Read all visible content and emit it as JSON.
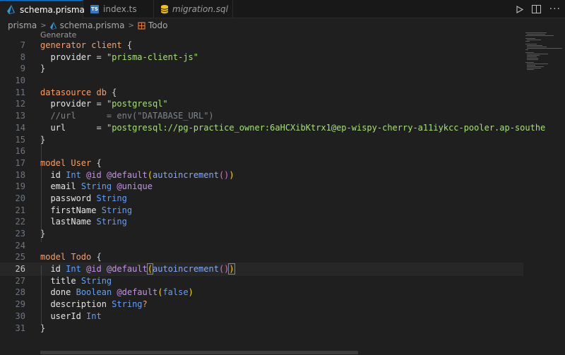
{
  "tabs": [
    {
      "label": "schema.prisma",
      "active": true,
      "icon": "prisma-icon",
      "close": "✕"
    },
    {
      "label": "index.ts",
      "active": false,
      "icon": "ts-icon",
      "icon_text": "TS"
    },
    {
      "label": "migration.sql",
      "active": false,
      "icon": "database-icon",
      "italic": true
    }
  ],
  "breadcrumb": {
    "folder": "prisma",
    "file": "schema.prisma",
    "symbol": "Todo"
  },
  "codelens": "Generate",
  "colors": {
    "accent": "#0078d4",
    "prisma_icon": "#2d9cdb",
    "sql_icon": "#f1c40f",
    "model_icon": "#e37933"
  },
  "lines": [
    {
      "n": "7"
    },
    {
      "n": "8"
    },
    {
      "n": "9"
    },
    {
      "n": "10"
    },
    {
      "n": "11"
    },
    {
      "n": "12"
    },
    {
      "n": "13"
    },
    {
      "n": "14"
    },
    {
      "n": "15"
    },
    {
      "n": "16"
    },
    {
      "n": "17"
    },
    {
      "n": "18"
    },
    {
      "n": "19"
    },
    {
      "n": "20"
    },
    {
      "n": "21"
    },
    {
      "n": "22"
    },
    {
      "n": "23"
    },
    {
      "n": "24"
    },
    {
      "n": "25"
    },
    {
      "n": "26"
    },
    {
      "n": "27"
    },
    {
      "n": "28"
    },
    {
      "n": "29"
    },
    {
      "n": "30"
    },
    {
      "n": "31"
    }
  ],
  "tokens": {
    "generator": "generator",
    "client": "client",
    "lbrace": "{",
    "rbrace": "}",
    "provider": "provider",
    "eq": "=",
    "prisma_client_js": "\"prisma-client-js\"",
    "datasource": "datasource",
    "db": "db",
    "postgresql": "\"postgresql\"",
    "url_comment": "//url      = env(\"DATABASE_URL\")",
    "url": "url",
    "url_value": "\"postgresql://pg-practice_owner:6aHCXibKtrx1@ep-wispy-cherry-a11iykcc-pooler.ap-southe",
    "model": "model",
    "User": "User",
    "Todo": "Todo",
    "id": "id",
    "Int": "Int",
    "at_id": "@id",
    "at_default": "@default",
    "lparen": "(",
    "rparen": ")",
    "autoincrement": "autoincrement",
    "empty_parens": "()",
    "email": "email",
    "String": "String",
    "at_unique": "@unique",
    "password": "password",
    "firstName": "firstName",
    "lastName": "lastName",
    "title": "title",
    "done": "done",
    "Boolean": "Boolean",
    "false": "false",
    "description": "description",
    "qmark": "?",
    "userId": "userId"
  }
}
